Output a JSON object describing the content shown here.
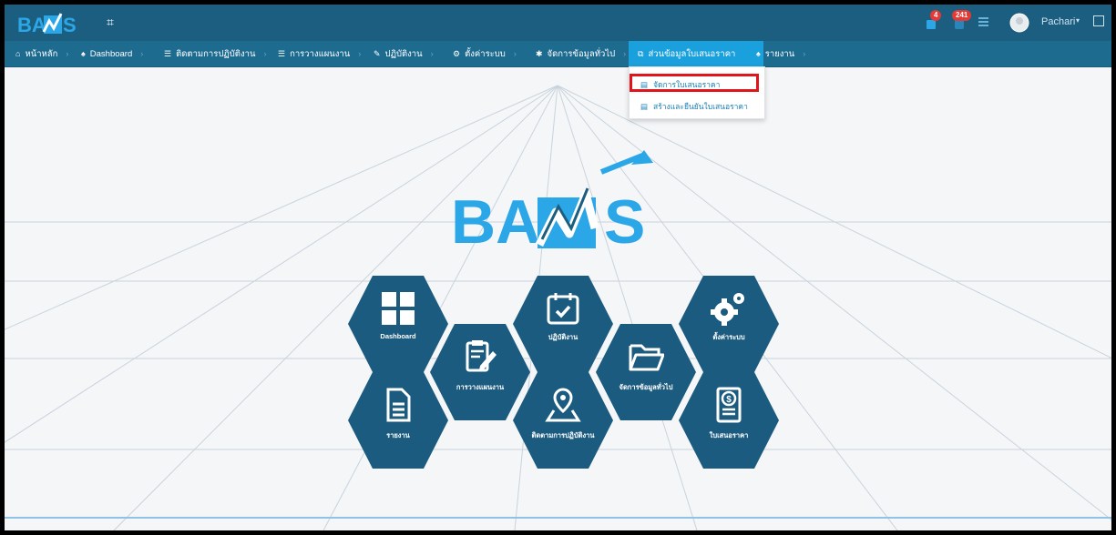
{
  "header": {
    "logo_text": "BAMS",
    "collapse_icon": "grid-icon",
    "badges": {
      "cart": "4",
      "notifications": "241"
    },
    "user_name": "Pachari"
  },
  "nav": {
    "items": [
      {
        "label": "หน้าหลัก",
        "icon": "home-icon"
      },
      {
        "label": "Dashboard",
        "icon": "fire-icon"
      },
      {
        "label": "ติดตามการปฏิบัติงาน",
        "icon": "list-icon"
      },
      {
        "label": "การวางแผนงาน",
        "icon": "list-icon"
      },
      {
        "label": "ปฏิบัติงาน",
        "icon": "edit-icon"
      },
      {
        "label": "ตั้งค่าระบบ",
        "icon": "gears-icon"
      },
      {
        "label": "จัดการข้อมูลทั่วไป",
        "icon": "gear-icon"
      },
      {
        "label": "ส่วนข้อมูลใบเสนอราคา",
        "icon": "copy-icon"
      },
      {
        "label": "รายงาน",
        "icon": "fire-icon"
      }
    ],
    "active_index": 7
  },
  "dropdown": {
    "items": [
      {
        "label": "จัดการใบเสนอราคา",
        "icon": "doc-icon"
      },
      {
        "label": "สร้างและยืนยันใบเสนอราคา",
        "icon": "doc-icon"
      }
    ]
  },
  "main": {
    "logo_text": "BAMS",
    "tiles": [
      {
        "label": "Dashboard",
        "icon": "dashboard-grid-icon"
      },
      {
        "label": "การวางแผนงาน",
        "icon": "clipboard-edit-icon"
      },
      {
        "label": "ปฏิบัติงาน",
        "icon": "calendar-check-icon"
      },
      {
        "label": "จัดการข้อมูลทั่วไป",
        "icon": "folder-open-icon"
      },
      {
        "label": "ตั้งค่าระบบ",
        "icon": "gears-icon"
      },
      {
        "label": "รายงาน",
        "icon": "file-text-icon"
      },
      {
        "label": "ติดตามการปฏิบัติงาน",
        "icon": "map-pin-icon"
      },
      {
        "label": "ใบเสนอราคา",
        "icon": "invoice-dollar-icon"
      }
    ]
  },
  "colors": {
    "topbar": "#1c5e80",
    "navbar": "#1e6b90",
    "active_nav": "#1aa0dc",
    "hex_fill": "#1b5b7f",
    "highlight": "#e2141b"
  }
}
